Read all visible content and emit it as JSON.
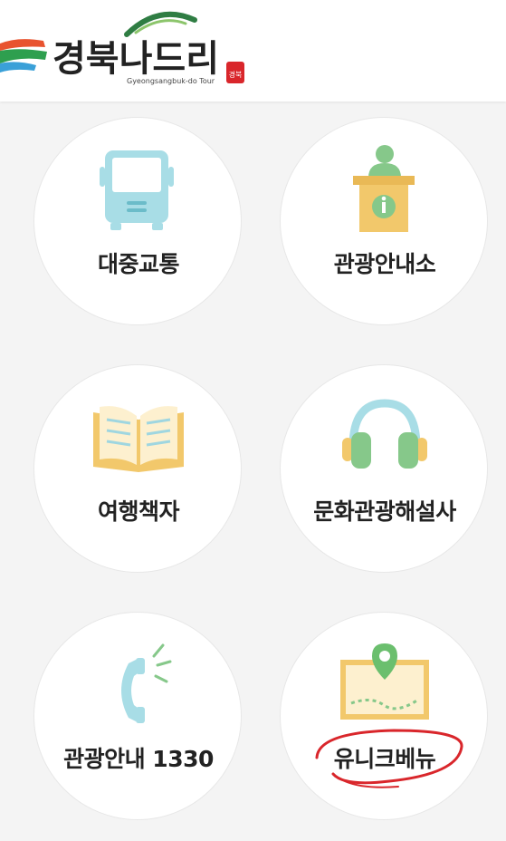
{
  "header": {
    "logo_text": "경북나드리",
    "logo_subtitle": "Gyeongsangbuk-do Tour",
    "seal_text": "경북"
  },
  "menu": [
    {
      "label": "대중교통",
      "icon": "bus-icon"
    },
    {
      "label": "관광안내소",
      "icon": "info-desk-icon"
    },
    {
      "label": "여행책자",
      "icon": "open-book-icon"
    },
    {
      "label": "문화관광해설사",
      "icon": "headphones-icon"
    },
    {
      "label": "관광안내 1330",
      "icon": "phone-icon"
    },
    {
      "label": "유니크베뉴",
      "icon": "map-pin-icon"
    }
  ],
  "colors": {
    "bus_blue": "#a8dde6",
    "accent_yellow": "#f2c86b",
    "accent_green": "#86c88a",
    "map_green": "#6bbf6e",
    "highlight_red": "#d9262b",
    "label_text": "#222222"
  }
}
